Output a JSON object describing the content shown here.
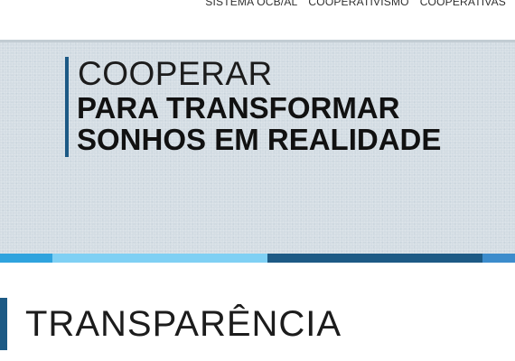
{
  "nav": {
    "items": [
      "SISTEMA OCB/AL",
      "COOPERATIVISMO",
      "COOPERATIVAS"
    ]
  },
  "hero": {
    "line1": "COOPERAR",
    "line2": "PARA TRANSFORMAR",
    "line3": "SONHOS EM REALIDADE"
  },
  "stripe_colors": [
    "#2fa3de",
    "#7fd0f4",
    "#1d5a85",
    "#3c8ccc"
  ],
  "section": {
    "title": "TRANSPARÊNCIA"
  }
}
